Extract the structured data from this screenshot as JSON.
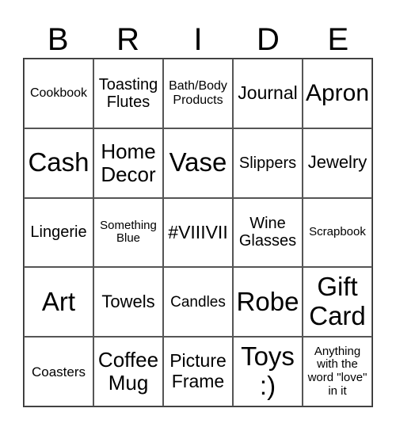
{
  "header": [
    "B",
    "R",
    "I",
    "D",
    "E"
  ],
  "cells": [
    [
      "Cookbook",
      "Toasting Flutes",
      "Bath/Body Products",
      "Journal",
      "Apron"
    ],
    [
      "Cash",
      "Home Decor",
      "Vase",
      "Slippers",
      "Jewelry"
    ],
    [
      "Lingerie",
      "Something Blue",
      "#VIIIVII",
      "Wine Glasses",
      "Scrapbook"
    ],
    [
      "Art",
      "Towels",
      "Candles",
      "Robe",
      "Gift Card"
    ],
    [
      "Coasters",
      "Coffee Mug",
      "Picture Frame",
      "Toys :)",
      "Anything with the word \"love\" in it"
    ]
  ]
}
